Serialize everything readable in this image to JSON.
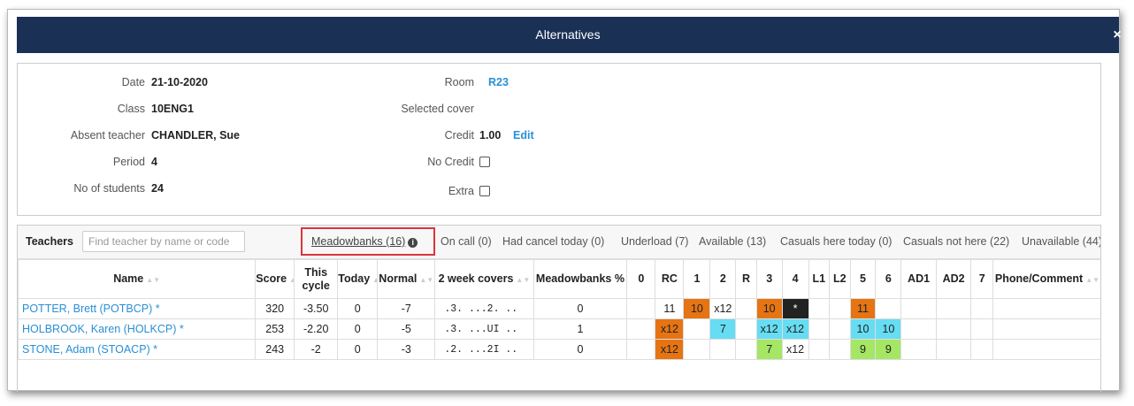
{
  "modal": {
    "title": "Alternatives",
    "close_label": "×"
  },
  "details": {
    "left": [
      {
        "label": "Date",
        "value": "21-10-2020"
      },
      {
        "label": "Class",
        "value": "10ENG1"
      },
      {
        "label": "Absent teacher",
        "value": "CHANDLER, Sue"
      },
      {
        "label": "Period",
        "value": "4"
      },
      {
        "label": "No of students",
        "value": "24"
      }
    ],
    "room": {
      "label": "Room",
      "value": "R23"
    },
    "selected_cover": {
      "label": "Selected cover",
      "value": ""
    },
    "credit": {
      "label": "Credit",
      "value": "1.00",
      "edit_label": "Edit"
    },
    "no_credit": {
      "label": "No Credit",
      "checked": false
    },
    "extra": {
      "label": "Extra",
      "checked": false
    }
  },
  "toolbar": {
    "label": "Teachers",
    "search_placeholder": "Find teacher by name or code",
    "tabs": [
      {
        "label": "Meadowbanks (16)",
        "active": true
      },
      {
        "label": "On call (0)"
      },
      {
        "label": "Had cancel today (0)"
      },
      {
        "label": "Underload (7)"
      },
      {
        "label": "Available (13)"
      },
      {
        "label": "Casuals here today (0)"
      },
      {
        "label": "Casuals not here (22)"
      },
      {
        "label": "Unavailable (44)"
      }
    ]
  },
  "columns": [
    "Name",
    "Score",
    "This cycle",
    "Today",
    "Normal",
    "2 week covers",
    "Meadowbanks %",
    "0",
    "RC",
    "1",
    "2",
    "R",
    "3",
    "4",
    "L1",
    "L2",
    "5",
    "6",
    "AD1",
    "AD2",
    "7",
    "Phone/Comment"
  ],
  "rows": [
    {
      "name": "POTTER, Brett (POTBCP) *",
      "score": "320",
      "this_cycle": "-3.50",
      "today": "0",
      "normal": "-7",
      "two_week": ".3.  ...2.  ..",
      "meadowbanks_pct": "0",
      "periods": [
        "",
        "11",
        "10",
        "x12",
        "",
        "10",
        "*",
        "",
        "",
        "11",
        "",
        "",
        "",
        "",
        ""
      ]
    },
    {
      "name": "HOLBROOK, Karen (HOLKCP) *",
      "score": "253",
      "this_cycle": "-2.20",
      "today": "0",
      "normal": "-5",
      "two_week": ".3.  ...UI  ..",
      "meadowbanks_pct": "1",
      "periods": [
        "",
        "x12",
        "",
        "7",
        "",
        "x12",
        "x12",
        "",
        "",
        "10",
        "10",
        "",
        "",
        "",
        ""
      ]
    },
    {
      "name": "STONE, Adam (STOACP) *",
      "score": "243",
      "this_cycle": "-2",
      "today": "0",
      "normal": "-3",
      "two_week": ".2.  ...2I  ..",
      "meadowbanks_pct": "0",
      "periods": [
        "",
        "x12",
        "",
        "",
        "",
        "7",
        "x12",
        "",
        "",
        "9",
        "9",
        "",
        "",
        "",
        ""
      ]
    }
  ],
  "colors": {
    "title_bar": "#1b3055",
    "link": "#2a8fd6",
    "orange": "#e67413",
    "black": "#222222",
    "cyan": "#66ddf2",
    "lime": "#a5e665",
    "highlight": "#d9363e"
  }
}
